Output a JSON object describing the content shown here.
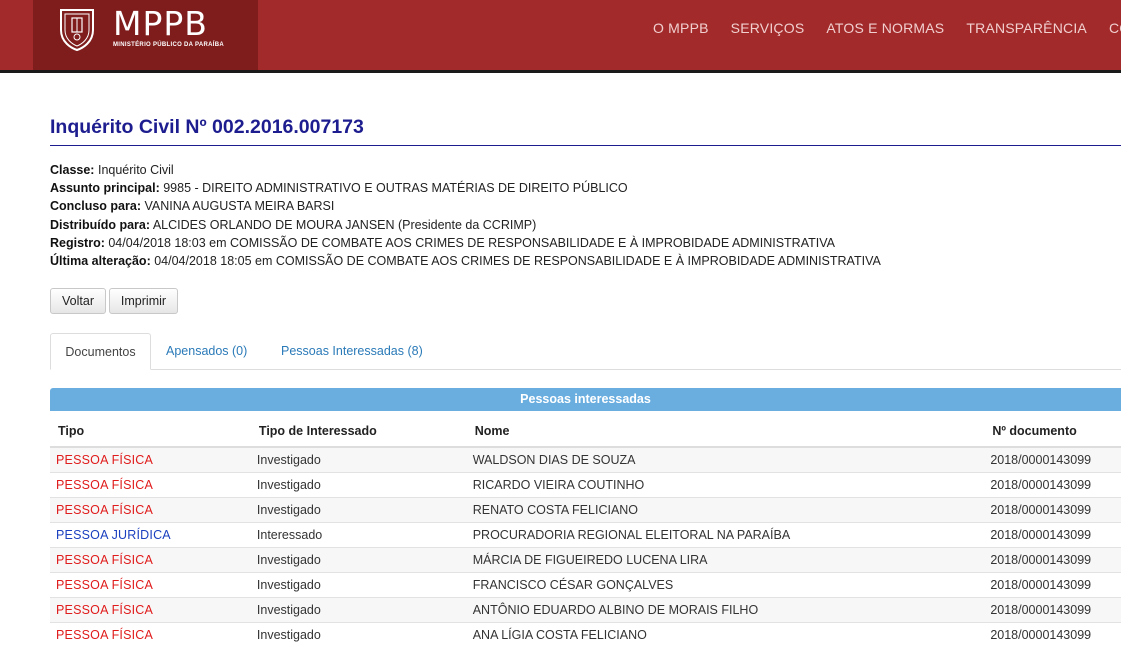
{
  "header": {
    "logo_title": "MPPB",
    "logo_subtitle": "MINISTÉRIO PÚBLICO DA PARAÍBA",
    "nav": [
      "O MPPB",
      "SERVIÇOS",
      "ATOS E NORMAS",
      "TRANSPARÊNCIA",
      "COM"
    ]
  },
  "page": {
    "title": "Inquérito Civil Nº 002.2016.007173",
    "fields": [
      {
        "label": "Classe:",
        "value": "Inquérito Civil"
      },
      {
        "label": "Assunto principal:",
        "value": "9985 - DIREITO ADMINISTRATIVO E OUTRAS MATÉRIAS DE DIREITO PÚBLICO"
      },
      {
        "label": "Concluso para:",
        "value": "VANINA AUGUSTA MEIRA BARSI"
      },
      {
        "label": "Distribuído para:",
        "value": "ALCIDES ORLANDO DE MOURA JANSEN (Presidente da CCRIMP)"
      },
      {
        "label": "Registro:",
        "value": "04/04/2018 18:03 em COMISSÃO DE COMBATE AOS CRIMES DE RESPONSABILIDADE E À IMPROBIDADE ADMINISTRATIVA"
      },
      {
        "label": "Última alteração:",
        "value": "04/04/2018 18:05 em COMISSÃO DE COMBATE AOS CRIMES DE RESPONSABILIDADE E À IMPROBIDADE ADMINISTRATIVA"
      }
    ],
    "buttons": {
      "back": "Voltar",
      "print": "Imprimir"
    },
    "tabs": [
      "Documentos",
      "Apensados (0)",
      "Pessoas Interessadas (8)"
    ]
  },
  "table": {
    "caption": "Pessoas interessadas",
    "headers": [
      "Tipo",
      "Tipo de Interessado",
      "Nome",
      "Nº documento"
    ],
    "rows": [
      {
        "tipo": "PESSOA FÍSICA",
        "interessado": "Investigado",
        "nome": "WALDSON DIAS DE SOUZA",
        "doc": "2018/0000143099"
      },
      {
        "tipo": "PESSOA FÍSICA",
        "interessado": "Investigado",
        "nome": "RICARDO VIEIRA COUTINHO",
        "doc": "2018/0000143099"
      },
      {
        "tipo": "PESSOA FÍSICA",
        "interessado": "Investigado",
        "nome": "RENATO COSTA FELICIANO",
        "doc": "2018/0000143099"
      },
      {
        "tipo": "PESSOA JURÍDICA",
        "interessado": "Interessado",
        "nome": "PROCURADORIA REGIONAL ELEITORAL NA PARAÍBA",
        "doc": "2018/0000143099"
      },
      {
        "tipo": "PESSOA FÍSICA",
        "interessado": "Investigado",
        "nome": "MÁRCIA DE FIGUEIREDO LUCENA LIRA",
        "doc": "2018/0000143099"
      },
      {
        "tipo": "PESSOA FÍSICA",
        "interessado": "Investigado",
        "nome": "FRANCISCO CÉSAR GONÇALVES",
        "doc": "2018/0000143099"
      },
      {
        "tipo": "PESSOA FÍSICA",
        "interessado": "Investigado",
        "nome": "ANTÔNIO EDUARDO ALBINO DE MORAIS FILHO",
        "doc": "2018/0000143099"
      },
      {
        "tipo": "PESSOA FÍSICA",
        "interessado": "Investigado",
        "nome": "ANA LÍGIA COSTA FELICIANO",
        "doc": "2018/0000143099"
      }
    ]
  },
  "colors": {
    "header_bg": "#a22a2a",
    "logo_bg": "#7f1c1c",
    "title": "#1d1d8f",
    "pessoa_fisica": "#e01b1b",
    "pessoa_juridica": "#1a3fbf",
    "panel_head": "#6aaee0"
  }
}
